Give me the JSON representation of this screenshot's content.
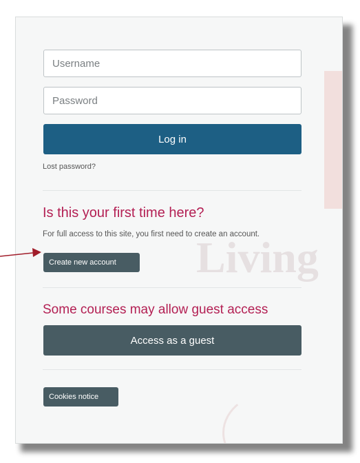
{
  "login_form": {
    "username_placeholder": "Username",
    "password_placeholder": "Password",
    "login_label": "Log in",
    "lost_password_label": "Lost password?"
  },
  "signup": {
    "heading": "Is this your first time here?",
    "description": "For full access to this site, you first need to create an account.",
    "create_account_label": "Create new account"
  },
  "guest": {
    "heading": "Some courses may allow guest access",
    "access_label": "Access as a guest"
  },
  "footer": {
    "cookies_label": "Cookies notice"
  },
  "annotation": {
    "arrow_color": "#a11d2a"
  },
  "colors": {
    "primary": "#1d5f84",
    "secondary": "#485c63",
    "heading": "#b31f53"
  }
}
